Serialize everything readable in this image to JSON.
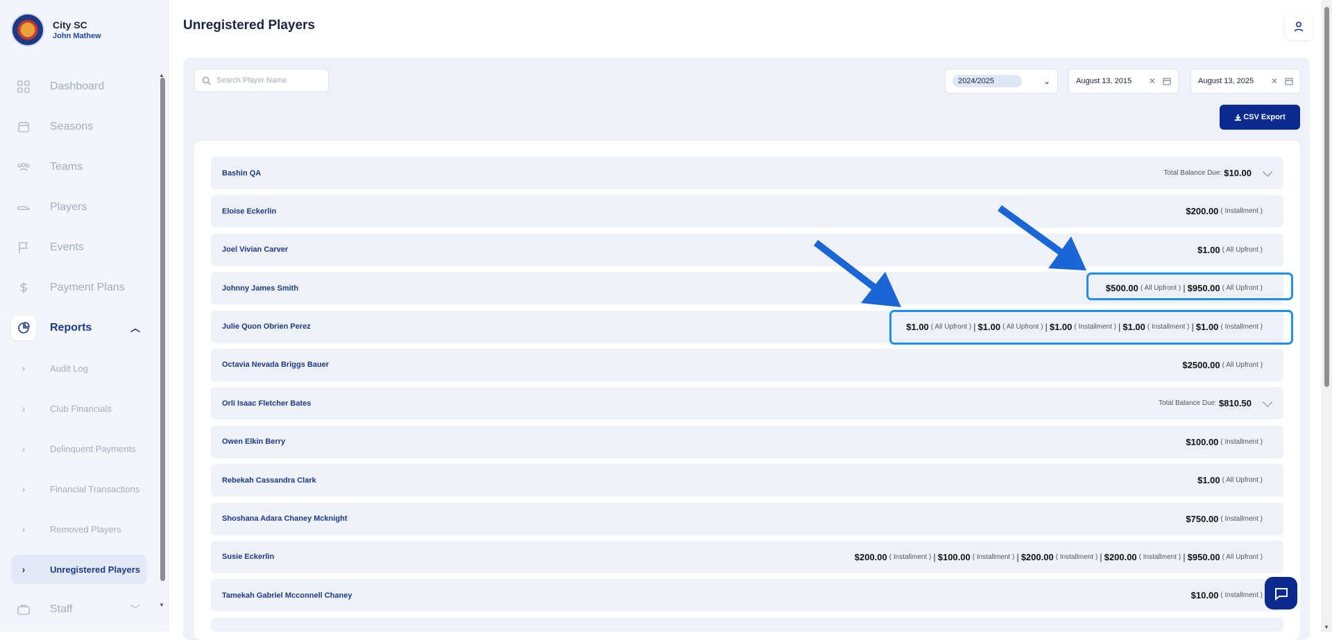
{
  "sidebar": {
    "club_name": "City SC",
    "user_name": "John Mathew",
    "items": [
      {
        "label": "Dashboard"
      },
      {
        "label": "Seasons"
      },
      {
        "label": "Teams"
      },
      {
        "label": "Players"
      },
      {
        "label": "Events"
      },
      {
        "label": "Payment Plans"
      },
      {
        "label": "Reports"
      },
      {
        "label": "Staff"
      }
    ],
    "report_subitems": [
      {
        "label": "Audit Log"
      },
      {
        "label": "Club Financials"
      },
      {
        "label": "Delinquent Payments"
      },
      {
        "label": "Financial Transactions"
      },
      {
        "label": "Removed Players"
      },
      {
        "label": "Unregistered Players"
      }
    ]
  },
  "header": {
    "title": "Unregistered Players"
  },
  "filters": {
    "search_placeholder": "Search Player Name",
    "season": "2024/2025",
    "start_date": "August 13, 2015",
    "end_date": "August 13, 2025",
    "export_label": "CSV Export"
  },
  "rows": [
    {
      "name": "Bashin QA",
      "balance_label": "Total Balance Due:",
      "balance": "$10.00"
    },
    {
      "name": "Eloise Eckerlin",
      "amt0": "$200.00",
      "typ0": "( Installment )"
    },
    {
      "name": "Joel Vivian Carver",
      "amt0": "$1.00",
      "typ0": "( All Upfront )"
    },
    {
      "name": "Johnny James Smith",
      "amt0": "$500.00",
      "typ0": "( All Upfront )",
      "amt1": "$950.00",
      "typ1": "( All Upfront )"
    },
    {
      "name": "Julie Quon Obrien Perez",
      "amt0": "$1.00",
      "typ0": "( All Upfront )",
      "amt1": "$1.00",
      "typ1": "( All Upfront )",
      "amt2": "$1.00",
      "typ2": "( Installment )",
      "amt3": "$1.00",
      "typ3": "( Installment )",
      "amt4": "$1.00",
      "typ4": "( Installment )"
    },
    {
      "name": "Octavia Nevada Briggs Bauer",
      "amt0": "$2500.00",
      "typ0": "( All Upfront )"
    },
    {
      "name": "Orli Isaac Fletcher Bates",
      "balance_label": "Total Balance Due:",
      "balance": "$810.50"
    },
    {
      "name": "Owen Elkin Berry",
      "amt0": "$100.00",
      "typ0": "( Installment )"
    },
    {
      "name": "Rebekah Cassandra Clark",
      "amt0": "$1.00",
      "typ0": "( All Upfront )"
    },
    {
      "name": "Shoshana Adara Chaney Mcknight",
      "amt0": "$750.00",
      "typ0": "( Installment )"
    },
    {
      "name": "Susie Eckerlin",
      "amt0": "$200.00",
      "typ0": "( Installment )",
      "amt1": "$100.00",
      "typ1": "( Installment )",
      "amt2": "$200.00",
      "typ2": "( Installment )",
      "amt3": "$200.00",
      "typ3": "( Installment )",
      "amt4": "$950.00",
      "typ4": "( All Upfront )"
    },
    {
      "name": "Tamekah Gabriel Mcconnell Chaney",
      "amt0": "$10.00",
      "typ0": "( Installment )"
    }
  ],
  "colors": {
    "accent": "#0b2a8f",
    "highlight": "#1d8ff0",
    "arrow": "#1a66d6"
  }
}
